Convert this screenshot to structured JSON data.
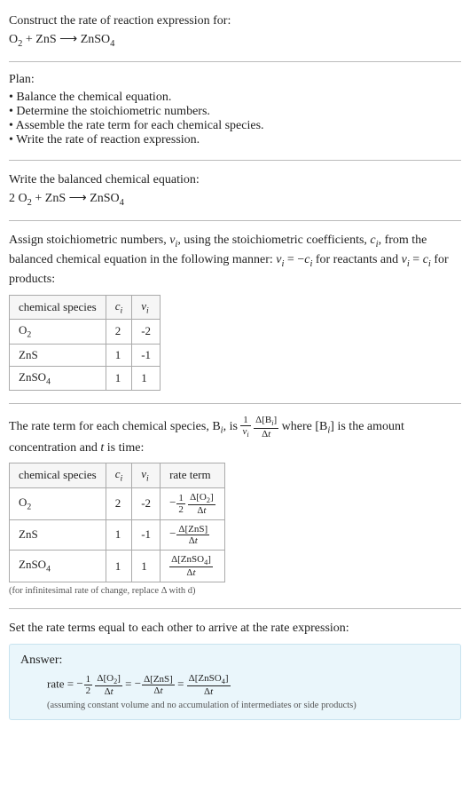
{
  "header": {
    "prompt": "Construct the rate of reaction expression for:"
  },
  "plan": {
    "title": "Plan:",
    "items": [
      "Balance the chemical equation.",
      "Determine the stoichiometric numbers.",
      "Assemble the rate term for each chemical species.",
      "Write the rate of reaction expression."
    ]
  },
  "balanced": {
    "title": "Write the balanced chemical equation:"
  },
  "assign": {
    "text_part1": "Assign stoichiometric numbers, ",
    "text_part2": ", using the stoichiometric coefficients, ",
    "text_part3": ", from the balanced chemical equation in the following manner: ",
    "text_part4": " for reactants and ",
    "text_part5": " for products:",
    "headers": {
      "species": "chemical species",
      "ci": "cᵢ",
      "vi": "νᵢ"
    },
    "rows": [
      {
        "species": "O₂",
        "ci": "2",
        "vi": "-2"
      },
      {
        "species": "ZnS",
        "ci": "1",
        "vi": "-1"
      },
      {
        "species": "ZnSO₄",
        "ci": "1",
        "vi": "1"
      }
    ]
  },
  "rateterm": {
    "lead1": "The rate term for each chemical species, ",
    "lead2": ", is ",
    "lead3": " where ",
    "lead4": " is the amount concentration and ",
    "lead5": " is time:",
    "headers": {
      "species": "chemical species",
      "ci": "cᵢ",
      "vi": "νᵢ",
      "rate": "rate term"
    },
    "note": "(for infinitesimal rate of change, replace Δ with d)"
  },
  "final": {
    "title": "Set the rate terms equal to each other to arrive at the rate expression:",
    "answer_label": "Answer:",
    "note": "(assuming constant volume and no accumulation of intermediates or side products)"
  },
  "chart_data": {
    "type": "table",
    "tables": [
      {
        "title": "stoichiometric numbers",
        "columns": [
          "chemical species",
          "c_i",
          "ν_i"
        ],
        "rows": [
          [
            "O2",
            2,
            -2
          ],
          [
            "ZnS",
            1,
            -1
          ],
          [
            "ZnSO4",
            1,
            1
          ]
        ]
      },
      {
        "title": "rate terms",
        "columns": [
          "chemical species",
          "c_i",
          "ν_i",
          "rate term"
        ],
        "rows": [
          [
            "O2",
            2,
            -2,
            "-(1/2) Δ[O2]/Δt"
          ],
          [
            "ZnS",
            1,
            -1,
            "-Δ[ZnS]/Δt"
          ],
          [
            "ZnSO4",
            1,
            1,
            "Δ[ZnSO4]/Δt"
          ]
        ]
      }
    ],
    "equations": {
      "unbalanced": "O2 + ZnS → ZnSO4",
      "balanced": "2 O2 + ZnS → ZnSO4",
      "rate_expression": "rate = -(1/2) Δ[O2]/Δt = -Δ[ZnS]/Δt = Δ[ZnSO4]/Δt"
    }
  }
}
